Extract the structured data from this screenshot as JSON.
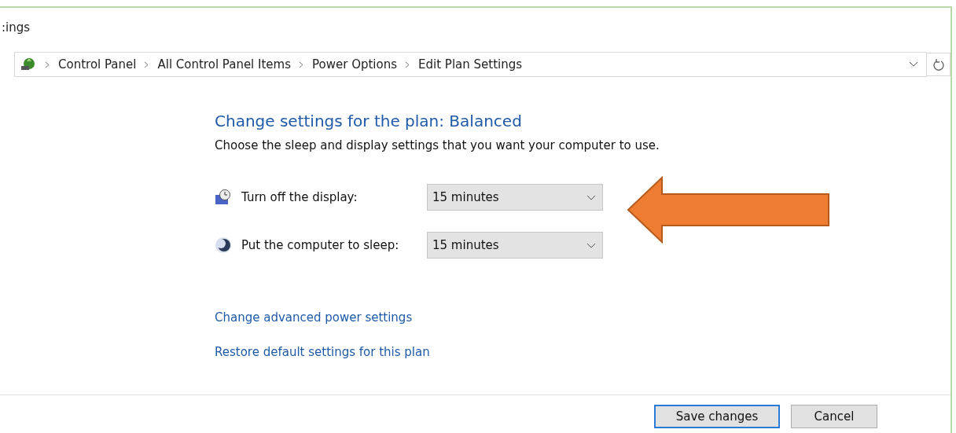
{
  "window": {
    "title": ":ings"
  },
  "address_bar": {
    "crumbs": [
      "Control Panel",
      "All Control Panel Items",
      "Power Options",
      "Edit Plan Settings"
    ]
  },
  "heading": "Change settings for the plan: Balanced",
  "subheading": "Choose the sleep and display settings that you want your computer to use.",
  "settings": [
    {
      "kind": "display",
      "label": "Turn off the display:",
      "value": "15 minutes"
    },
    {
      "kind": "sleep",
      "label": "Put the computer to sleep:",
      "value": "15 minutes"
    }
  ],
  "links": [
    "Change advanced power settings",
    "Restore default settings for this plan"
  ],
  "buttons": [
    {
      "label": "Save changes",
      "default": true
    },
    {
      "label": "Cancel",
      "default": false
    }
  ]
}
